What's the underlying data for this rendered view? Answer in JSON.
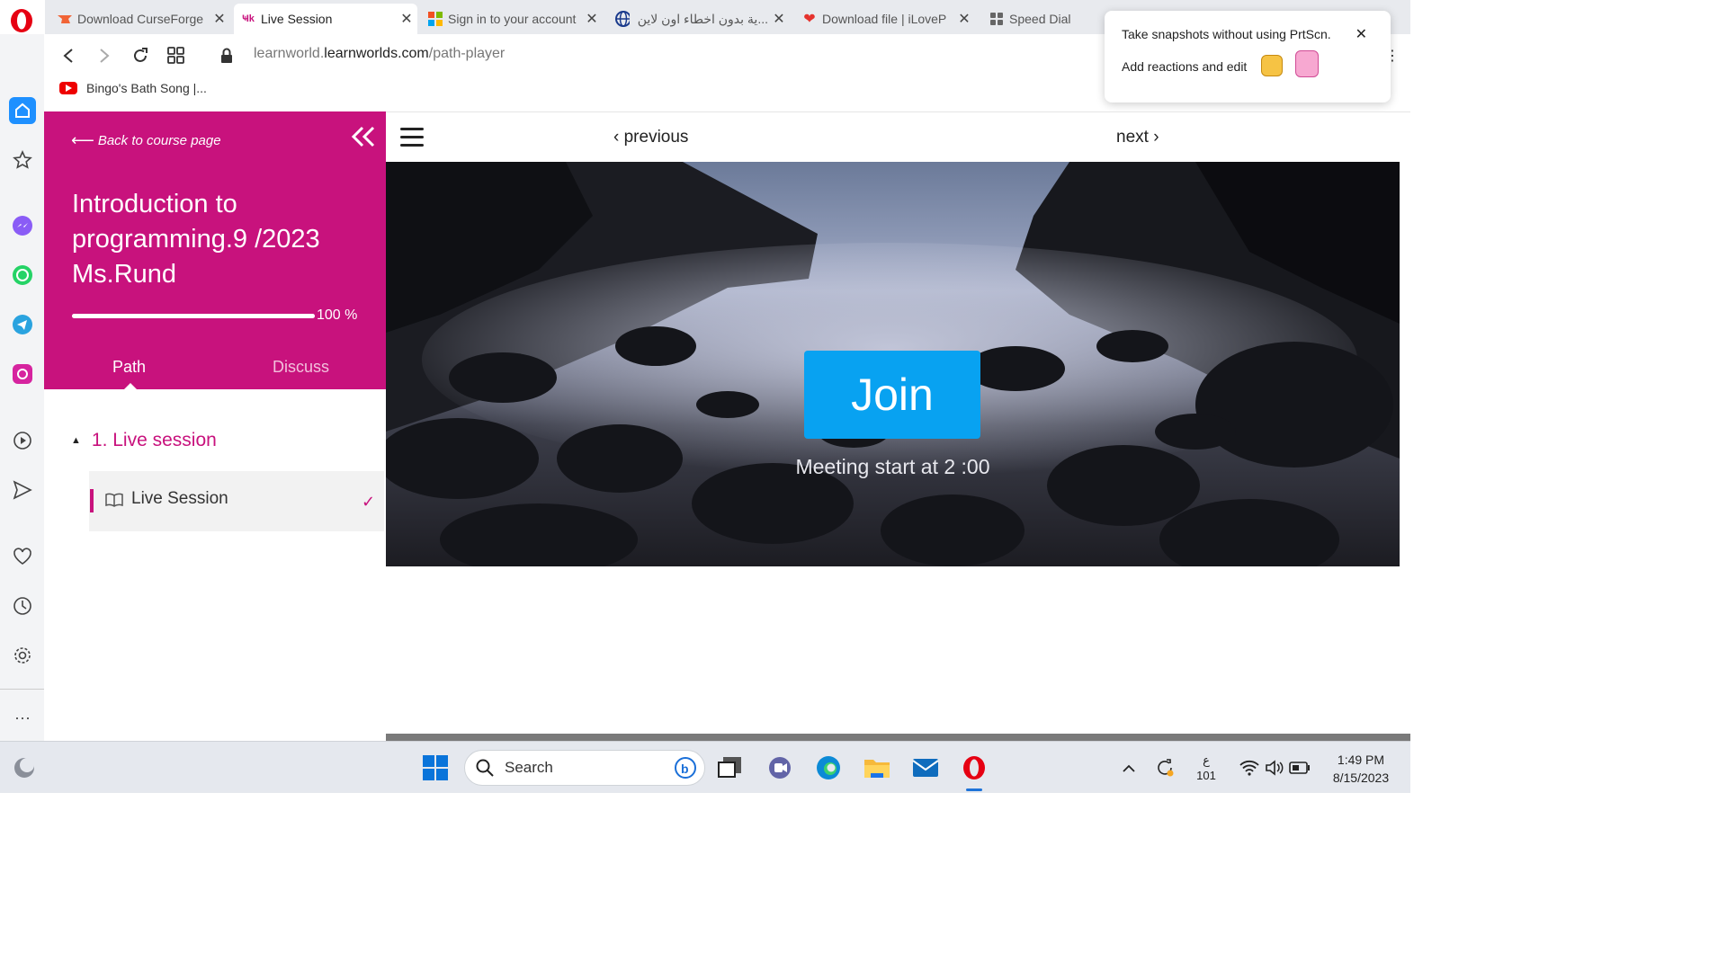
{
  "browser": {
    "tabs": [
      {
        "title": "Download CurseForge",
        "icon": "curseforge-icon",
        "active": false
      },
      {
        "title": "Live Session",
        "icon": "learnworlds-icon",
        "active": true
      },
      {
        "title": "Sign in to your account",
        "icon": "microsoft-icon",
        "active": false
      },
      {
        "title": "...ية بدون اخطاء اون لاين",
        "icon": "globe-icon",
        "active": false
      },
      {
        "title": "Download file | iLoveP",
        "icon": "heart-icon",
        "active": false
      },
      {
        "title": "Speed Dial",
        "icon": "speed-dial-icon",
        "active": false
      }
    ],
    "url_host_prefix": "learnworld.",
    "url_host": "learnworlds.com",
    "url_path": "/path-player",
    "bookmark": "Bingo's Bath Song |...",
    "snapshot_popup": {
      "line1": "Take snapshots without using PrtScn.",
      "line2": "Add reactions and edit"
    }
  },
  "course": {
    "back_label": "Back to course page",
    "title": "Introduction to programming.9 /2023 Ms.Rund",
    "progress_percent": 100,
    "progress_label": "100 %",
    "tabs": {
      "path": "Path",
      "discuss": "Discuss"
    },
    "section_title": "1. Live session",
    "lesson_title": "Live Session",
    "lesson_completed": true,
    "accent_color": "#c8127d"
  },
  "player": {
    "previous_label": "previous",
    "next_label": "next",
    "join_label": "Join",
    "meeting_text": "Meeting start at 2 :00",
    "join_color": "#08a2f1"
  },
  "taskbar": {
    "search_label": "Search",
    "keyboard_lang": "ع",
    "keyboard_num": "101",
    "time": "1:49 PM",
    "date": "8/15/2023"
  }
}
